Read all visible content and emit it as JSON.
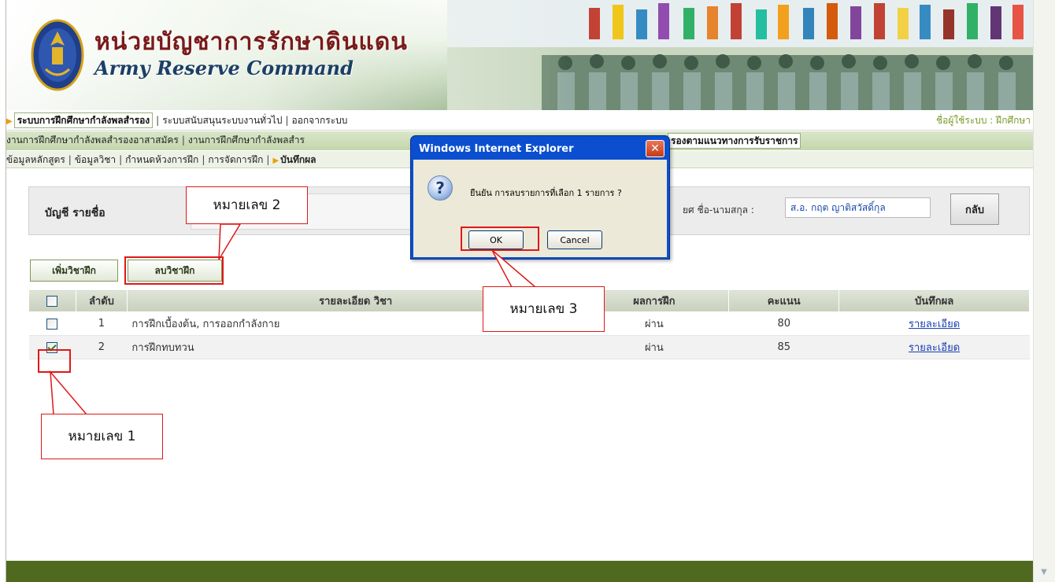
{
  "banner": {
    "title_th": "หน่วยบัญชาการรักษาดินแดน",
    "title_en": "Army Reserve Command"
  },
  "menu1": {
    "items": [
      "ระบบการฝึกศึกษากำลังพลสำรอง",
      "ระบบสนับสนุนระบบงานทั่วไป",
      "ออกจากระบบ"
    ],
    "user_label": "ชื่อผู้ใช้ระบบ : ฝึกศึกษา"
  },
  "menu2": {
    "items": [
      "งานการฝึกศึกษากำลังพลสำรองอาสาสมัคร",
      "งานการฝึกศึกษากำลังพลสำร"
    ],
    "active_item": "รองตามแนวทางการรับราชการ"
  },
  "menu3": {
    "items": [
      "ข้อมูลหลักสูตร",
      "ข้อมูลวิชา",
      "กำหนดห้วงการฝึก",
      "การจัดการฝึก"
    ],
    "current": "บันทึกผล"
  },
  "header": {
    "title": "บัญชี รายชื่อ",
    "rank_label": "ยศ ชื่อ-นามสกุล :",
    "name_value": "ส.อ. กฤต  ญาติสวัสดิ์กุล",
    "back_button": "กลับ"
  },
  "actions": {
    "add_button": "เพิ่มวิชาฝึก",
    "delete_button": "ลบวิชาฝึก"
  },
  "table": {
    "headers": {
      "order": "ลำดับ",
      "detail": "รายละเอียด วิชา",
      "result": "ผลการฝึก",
      "score": "คะแนน",
      "record": "บันทึกผล"
    },
    "rows": [
      {
        "order": "1",
        "detail": "การฝึกเบื้องต้น, การออกกำลังกาย",
        "result": "ผ่าน",
        "score": "80",
        "record": "รายละเอียด",
        "checked": false
      },
      {
        "order": "2",
        "detail": "การฝึกทบทวน",
        "result": "ผ่าน",
        "score": "85",
        "record": "รายละเอียด",
        "checked": true
      }
    ]
  },
  "dialog": {
    "title": "Windows Internet Explorer",
    "icon": "?",
    "message": "ยืนยัน การลบรายการที่เลือก 1 รายการ ?",
    "ok": "OK",
    "cancel": "Cancel",
    "close": "✕"
  },
  "callouts": {
    "c1": "หมายเลข 1",
    "c2": "หมายเลข 2",
    "c3": "หมายเลข 3"
  },
  "colors": {
    "highlight": "#e01818",
    "footer": "#4f6a1e",
    "link": "#1a40b0",
    "dialog_title_bar": "#0b4fd0"
  }
}
